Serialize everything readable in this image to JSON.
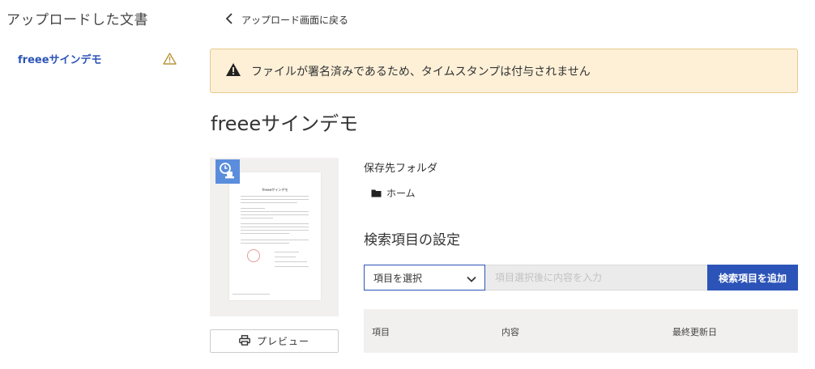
{
  "sidebar": {
    "title": "アップロードした文書",
    "items": [
      {
        "label": "freeeサインデモ",
        "status_icon": "warning-icon"
      }
    ]
  },
  "header": {
    "back_label": "アップロード画面に戻る"
  },
  "alert": {
    "message": "ファイルが署名済みであるため、タイムスタンプは付与されません",
    "icon": "warning-icon"
  },
  "document": {
    "title": "freeeサインデモ",
    "thumbnail_heading": "freeeサインデモ",
    "preview_label": "プレビュー"
  },
  "folder": {
    "heading": "保存先フォルダ",
    "name": "ホーム"
  },
  "search_settings": {
    "heading": "検索項目の設定",
    "select_label": "項目を選択",
    "input_placeholder": "項目選択後に内容を入力",
    "add_button": "検索項目を追加"
  },
  "table": {
    "columns": [
      "項目",
      "内容",
      "最終更新日"
    ]
  },
  "colors": {
    "accent": "#2c54b8",
    "alert_background": "#fdf0d7",
    "alert_border": "#e7c98e",
    "warning_icon_sidebar": "#b8973c",
    "stamp_badge": "#5b8ddd"
  }
}
